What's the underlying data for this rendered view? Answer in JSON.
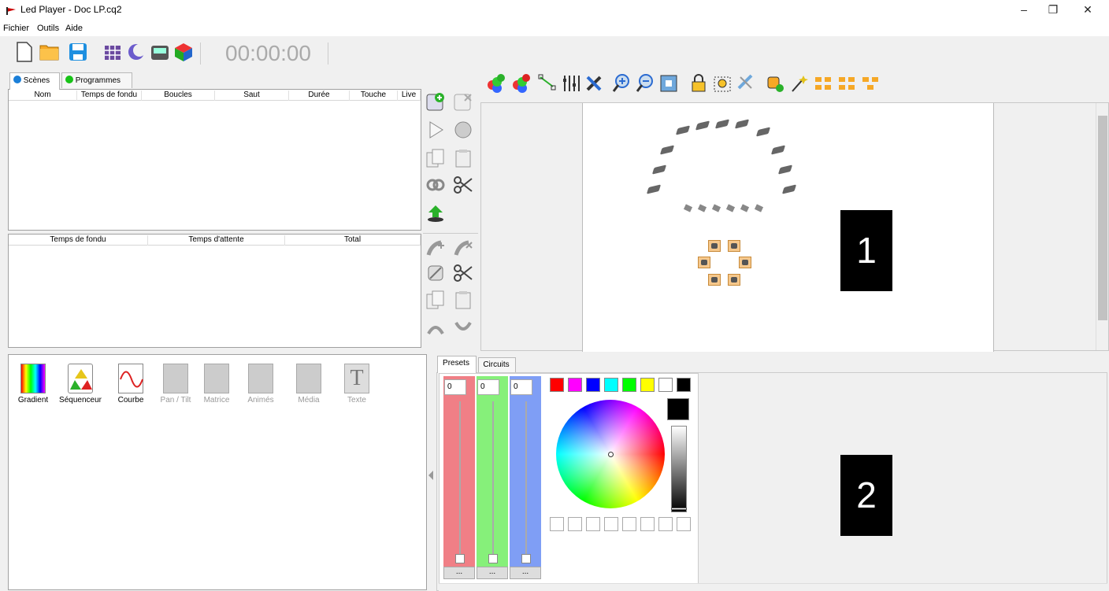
{
  "window": {
    "title": "Led Player - Doc LP.cq2"
  },
  "menu": {
    "items": [
      "Fichier",
      "Outils",
      "Aide"
    ]
  },
  "window_controls": {
    "minimize": "–",
    "restore": "❐",
    "close": "✕"
  },
  "toolbar": {
    "timer": "00:00:00"
  },
  "left_tabs": {
    "scenes": "Scènes",
    "programmes": "Programmes"
  },
  "scenes_table": {
    "columns": [
      "Nom",
      "Temps de fondu",
      "Boucles",
      "Saut",
      "Durée",
      "Touche",
      "Live"
    ]
  },
  "steps_table": {
    "columns": [
      "Temps de fondu",
      "Temps d'attente",
      "Total"
    ]
  },
  "effects": [
    {
      "label": "Gradient",
      "enabled": true
    },
    {
      "label": "Séquenceur",
      "enabled": true
    },
    {
      "label": "Courbe",
      "enabled": true
    },
    {
      "label": "Pan / Tilt",
      "enabled": false
    },
    {
      "label": "Matrice",
      "enabled": false
    },
    {
      "label": "Animés",
      "enabled": false
    },
    {
      "label": "Média",
      "enabled": false
    },
    {
      "label": "Texte",
      "enabled": false
    }
  ],
  "bottom_tabs": {
    "presets": "Presets",
    "circuits": "Circuits"
  },
  "sliders": [
    {
      "value": "0",
      "color": "#f07f86",
      "button": "..."
    },
    {
      "value": "0",
      "color": "#86f07a",
      "button": "..."
    },
    {
      "value": "0",
      "color": "#7f9ef5",
      "button": "..."
    }
  ],
  "swatches": [
    "#ff0000",
    "#ff00ff",
    "#0000ff",
    "#00ffff",
    "#00ff00",
    "#ffff00",
    "#ffffff",
    "#000000"
  ],
  "badges": {
    "one": "1",
    "two": "2"
  }
}
